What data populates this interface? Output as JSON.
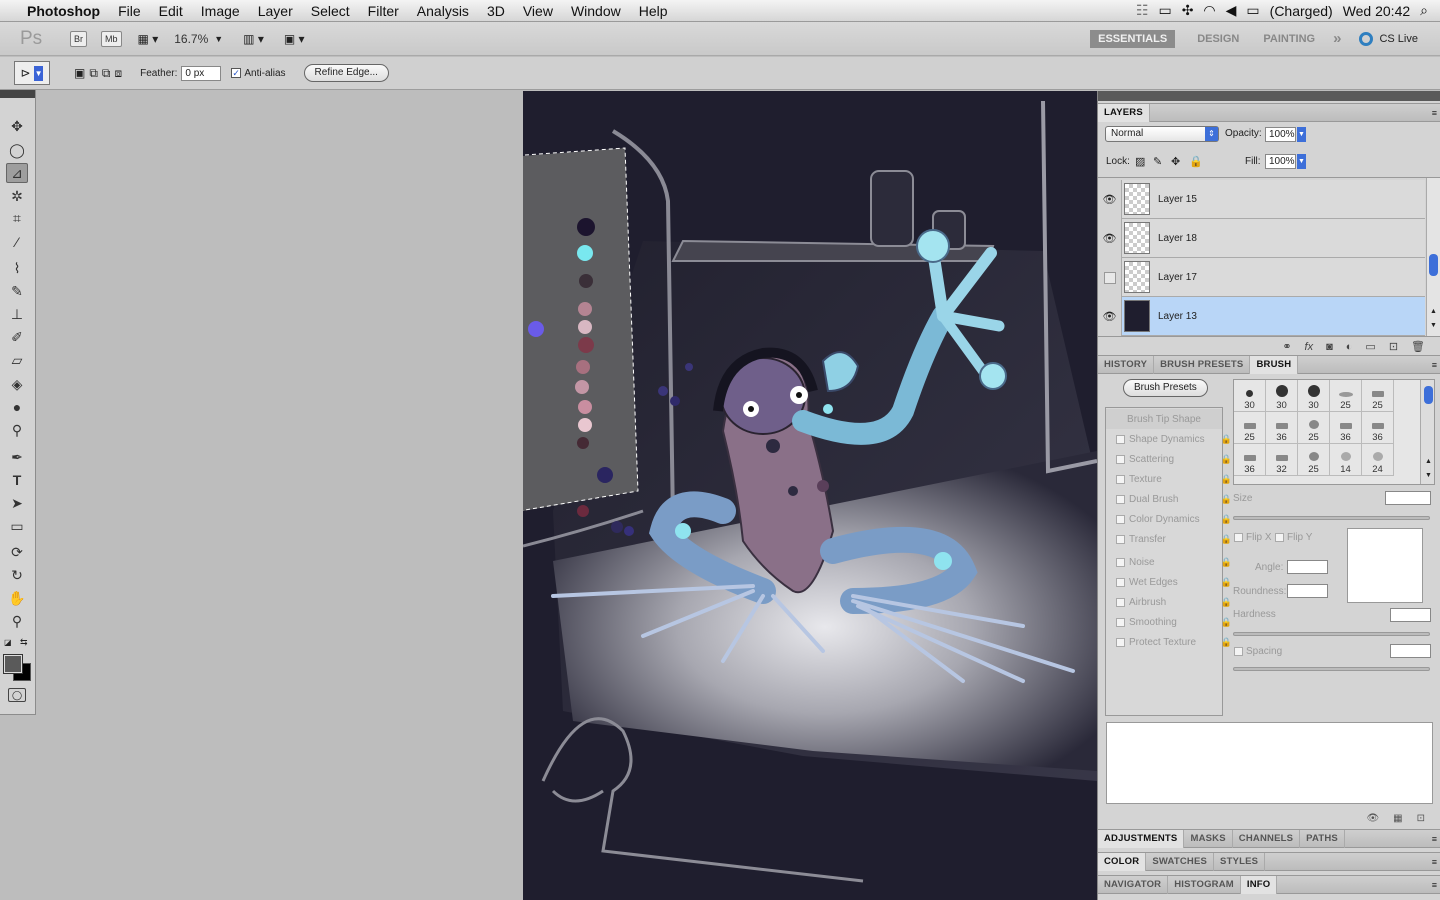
{
  "menubar": {
    "app": "Photoshop",
    "items": [
      "File",
      "Edit",
      "Image",
      "Layer",
      "Select",
      "Filter",
      "Analysis",
      "3D",
      "View",
      "Window",
      "Help"
    ],
    "battery": "(Charged)",
    "clock": "Wed 20:42"
  },
  "appbar": {
    "logo": "Ps",
    "bridge": "Br",
    "minibridge": "Mb",
    "zoom": "16.7%",
    "workspaces": [
      "ESSENTIALS",
      "DESIGN",
      "PAINTING"
    ],
    "more": "»",
    "cslive": "CS Live"
  },
  "options": {
    "feather_label": "Feather:",
    "feather_value": "0 px",
    "antialias_label": "Anti-alias",
    "refine_label": "Refine Edge..."
  },
  "layers_panel": {
    "title": "LAYERS",
    "blend_mode": "Normal",
    "opacity_label": "Opacity:",
    "opacity": "100%",
    "lock_label": "Lock:",
    "fill_label": "Fill:",
    "fill": "100%",
    "layers": [
      {
        "name": "Layer 15",
        "visible": true
      },
      {
        "name": "Layer 18",
        "visible": true
      },
      {
        "name": "Layer 17",
        "visible": false
      },
      {
        "name": "Layer 13",
        "visible": true
      }
    ]
  },
  "brush_tabs": [
    "HISTORY",
    "BRUSH PRESETS",
    "BRUSH"
  ],
  "brush_panel": {
    "presets_button": "Brush Presets",
    "options": [
      "Brush Tip Shape",
      "Shape Dynamics",
      "Scattering",
      "Texture",
      "Dual Brush",
      "Color Dynamics",
      "Transfer",
      "Noise",
      "Wet Edges",
      "Airbrush",
      "Smoothing",
      "Protect Texture"
    ],
    "sizes": [
      "30",
      "30",
      "30",
      "25",
      "25",
      "25",
      "36",
      "25",
      "36",
      "36",
      "36",
      "32",
      "25",
      "14",
      "24"
    ],
    "size_label": "Size",
    "flipx": "Flip X",
    "flipy": "Flip Y",
    "angle_label": "Angle:",
    "roundness_label": "Roundness:",
    "hardness_label": "Hardness",
    "spacing_label": "Spacing"
  },
  "adjust_tabs": [
    "ADJUSTMENTS",
    "MASKS",
    "CHANNELS",
    "PATHS"
  ],
  "color_tabs": [
    "COLOR",
    "SWATCHES",
    "STYLES"
  ],
  "nav_tabs": [
    "NAVIGATOR",
    "HISTOGRAM",
    "INFO"
  ],
  "colors": {
    "selected_layer": "#b9d6f7",
    "canvas_bg": "#1f1e2e",
    "foreground": "#5a5a5a",
    "background": "#000000"
  }
}
